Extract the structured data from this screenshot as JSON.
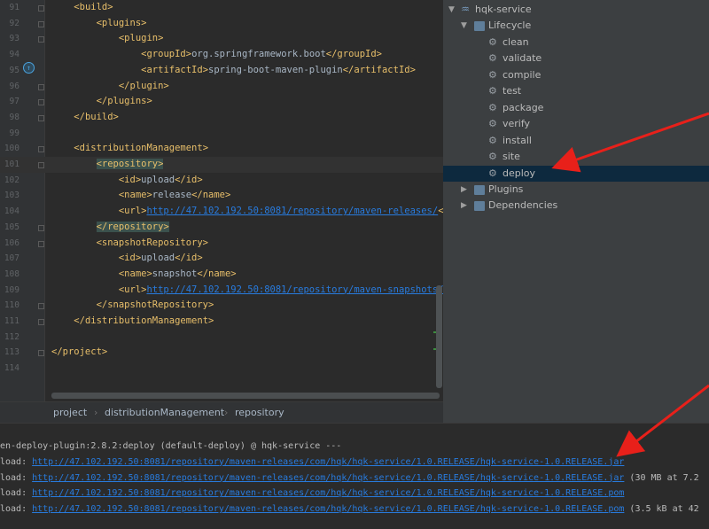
{
  "editor": {
    "lines": [
      {
        "num": "91",
        "parts": [
          {
            "t": "    ",
            "c": "plain"
          },
          {
            "t": "<build>",
            "c": "tag"
          }
        ]
      },
      {
        "num": "92",
        "parts": [
          {
            "t": "        ",
            "c": "plain"
          },
          {
            "t": "<plugins>",
            "c": "tag"
          }
        ]
      },
      {
        "num": "93",
        "parts": [
          {
            "t": "            ",
            "c": "plain"
          },
          {
            "t": "<plugin>",
            "c": "tag"
          }
        ]
      },
      {
        "num": "94",
        "parts": [
          {
            "t": "                ",
            "c": "plain"
          },
          {
            "t": "<groupId>",
            "c": "tag"
          },
          {
            "t": "org.springframework.boot",
            "c": "plain"
          },
          {
            "t": "</groupId>",
            "c": "tag"
          }
        ]
      },
      {
        "num": "95",
        "parts": [
          {
            "t": "                ",
            "c": "plain"
          },
          {
            "t": "<artifactId>",
            "c": "tag"
          },
          {
            "t": "spring-boot-maven-plugin",
            "c": "plain"
          },
          {
            "t": "</artifactId>",
            "c": "tag"
          }
        ]
      },
      {
        "num": "96",
        "parts": [
          {
            "t": "            ",
            "c": "plain"
          },
          {
            "t": "</plugin>",
            "c": "tag"
          }
        ]
      },
      {
        "num": "97",
        "parts": [
          {
            "t": "        ",
            "c": "plain"
          },
          {
            "t": "</plugins>",
            "c": "tag"
          }
        ]
      },
      {
        "num": "98",
        "parts": [
          {
            "t": "    ",
            "c": "plain"
          },
          {
            "t": "</build>",
            "c": "tag"
          }
        ]
      },
      {
        "num": "99",
        "parts": []
      },
      {
        "num": "100",
        "parts": [
          {
            "t": "    ",
            "c": "plain"
          },
          {
            "t": "<distributionManagement>",
            "c": "tag"
          }
        ]
      },
      {
        "num": "101",
        "current": true,
        "parts": [
          {
            "t": "        ",
            "c": "plain"
          },
          {
            "t": "<repository>",
            "c": "tag hl"
          }
        ]
      },
      {
        "num": "102",
        "parts": [
          {
            "t": "            ",
            "c": "plain"
          },
          {
            "t": "<id>",
            "c": "tag"
          },
          {
            "t": "upload",
            "c": "plain"
          },
          {
            "t": "</id>",
            "c": "tag"
          }
        ]
      },
      {
        "num": "103",
        "parts": [
          {
            "t": "            ",
            "c": "plain"
          },
          {
            "t": "<name>",
            "c": "tag"
          },
          {
            "t": "release",
            "c": "plain"
          },
          {
            "t": "</name>",
            "c": "tag"
          }
        ]
      },
      {
        "num": "104",
        "parts": [
          {
            "t": "            ",
            "c": "plain"
          },
          {
            "t": "<url>",
            "c": "tag"
          },
          {
            "t": "http://47.102.192.50:8081/repository/maven-releases/",
            "c": "url"
          },
          {
            "t": "</u",
            "c": "tag"
          }
        ]
      },
      {
        "num": "105",
        "parts": [
          {
            "t": "        ",
            "c": "plain"
          },
          {
            "t": "</repository>",
            "c": "tag hl"
          }
        ]
      },
      {
        "num": "106",
        "parts": [
          {
            "t": "        ",
            "c": "plain"
          },
          {
            "t": "<snapshotRepository>",
            "c": "tag"
          }
        ]
      },
      {
        "num": "107",
        "parts": [
          {
            "t": "            ",
            "c": "plain"
          },
          {
            "t": "<id>",
            "c": "tag"
          },
          {
            "t": "upload",
            "c": "plain"
          },
          {
            "t": "</id>",
            "c": "tag"
          }
        ]
      },
      {
        "num": "108",
        "parts": [
          {
            "t": "            ",
            "c": "plain"
          },
          {
            "t": "<name>",
            "c": "tag"
          },
          {
            "t": "snapshot",
            "c": "plain"
          },
          {
            "t": "</name>",
            "c": "tag"
          }
        ]
      },
      {
        "num": "109",
        "parts": [
          {
            "t": "            ",
            "c": "plain"
          },
          {
            "t": "<url>",
            "c": "tag"
          },
          {
            "t": "http://47.102.192.50:8081/repository/maven-snapshots/",
            "c": "url"
          },
          {
            "t": "</",
            "c": "tag"
          }
        ]
      },
      {
        "num": "110",
        "parts": [
          {
            "t": "        ",
            "c": "plain"
          },
          {
            "t": "</snapshotRepository>",
            "c": "tag"
          }
        ]
      },
      {
        "num": "111",
        "parts": [
          {
            "t": "    ",
            "c": "plain"
          },
          {
            "t": "</distributionManagement>",
            "c": "tag"
          }
        ]
      },
      {
        "num": "112",
        "parts": []
      },
      {
        "num": "113",
        "parts": [
          {
            "t": "</project>",
            "c": "tag"
          }
        ]
      },
      {
        "num": "114",
        "parts": []
      }
    ]
  },
  "breadcrumb": [
    "project",
    "distributionManagement",
    "repository"
  ],
  "maven": {
    "project": "hqk-service",
    "lifecycle_label": "Lifecycle",
    "goals": [
      "clean",
      "validate",
      "compile",
      "test",
      "package",
      "verify",
      "install",
      "site",
      "deploy"
    ],
    "selected_goal": "deploy",
    "plugins_label": "Plugins",
    "dependencies_label": "Dependencies"
  },
  "console": {
    "lines": [
      {
        "prefix": "en-deploy-plugin:2.8.2:deploy (default-deploy) @ hqk-service ---",
        "url": "",
        "suffix": ""
      },
      {
        "prefix": "load: ",
        "url": "http://47.102.192.50:8081/repository/maven-releases/com/hqk/hqk-service/1.0.RELEASE/hqk-service-1.0.RELEASE.jar",
        "suffix": ""
      },
      {
        "prefix": "load: ",
        "url": "http://47.102.192.50:8081/repository/maven-releases/com/hqk/hqk-service/1.0.RELEASE/hqk-service-1.0.RELEASE.jar",
        "suffix": " (30 MB at 7.2"
      },
      {
        "prefix": "load: ",
        "url": "http://47.102.192.50:8081/repository/maven-releases/com/hqk/hqk-service/1.0.RELEASE/hqk-service-1.0.RELEASE.pom",
        "suffix": ""
      },
      {
        "prefix": "load: ",
        "url": "http://47.102.192.50:8081/repository/maven-releases/com/hqk/hqk-service/1.0.RELEASE/hqk-service-1.0.RELEASE.pom",
        "suffix": " (3.5 kB at 42"
      }
    ]
  },
  "colors": {
    "arrow": "#e8201a",
    "selection": "#0d293e",
    "tag": "#e8bf6a",
    "url": "#287bde"
  }
}
